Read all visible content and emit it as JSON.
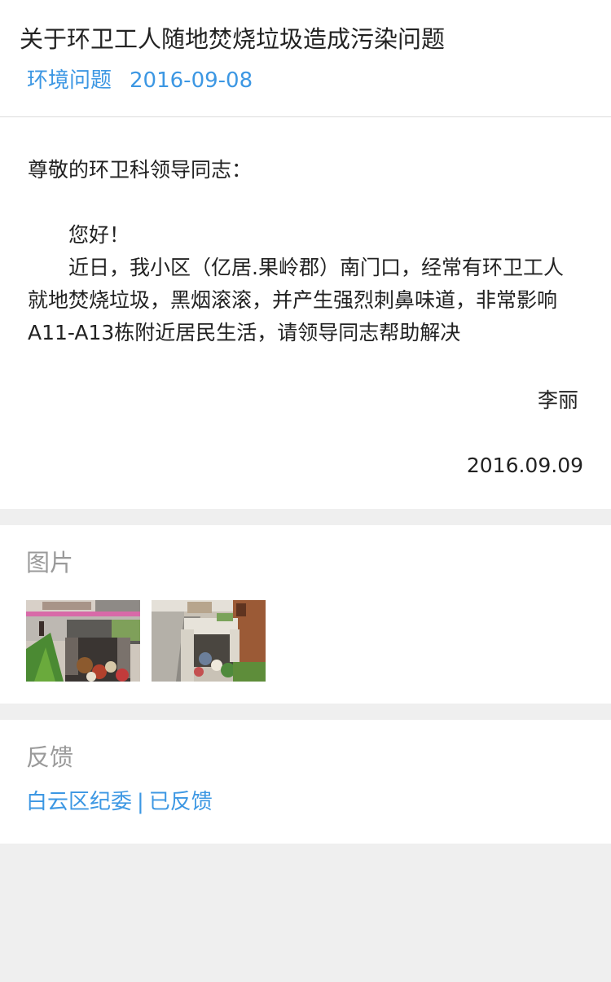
{
  "header": {
    "title": "关于环卫工人随地焚烧垃圾造成污染问题",
    "category": "环境问题",
    "date": "2016-09-08"
  },
  "letter": {
    "salutation": "尊敬的环卫科领导同志：",
    "greeting": "您好！",
    "body": "近日，我小区（亿居.果岭郡）南门口，经常有环卫工人就地焚烧垃圾，黑烟滚滚，并产生强烈刺鼻味道，非常影响A11-A13栋附近居民生活，请领导同志帮助解决",
    "signature": "李丽",
    "sign_date": "2016.09.09"
  },
  "images_section": {
    "title": "图片",
    "images": [
      {
        "icon": "photo-garbage-burning-1"
      },
      {
        "icon": "photo-garbage-burning-2"
      }
    ]
  },
  "feedback_section": {
    "title": "反馈",
    "department": "白云区纪委",
    "separator": "|",
    "status": "已反馈"
  },
  "colors": {
    "link": "#3c97e3",
    "muted": "#9a9a9a",
    "text": "#222222",
    "background": "#efefef"
  }
}
